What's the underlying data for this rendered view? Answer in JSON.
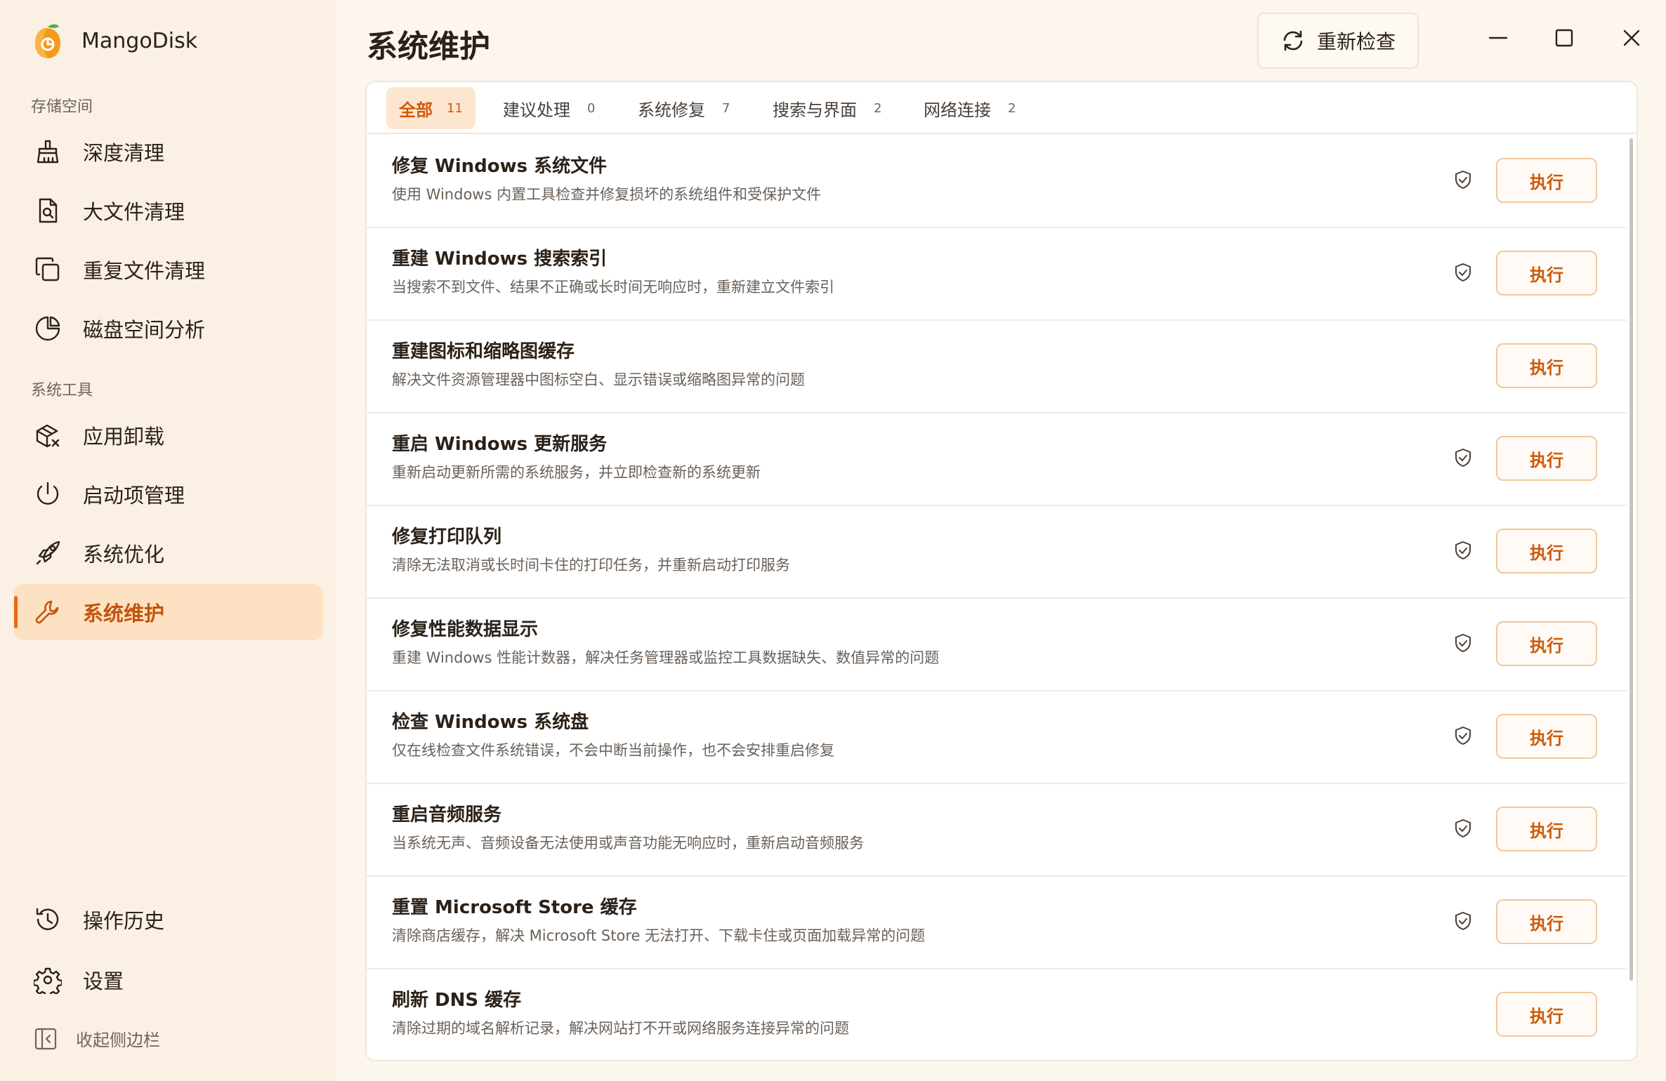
{
  "app": {
    "name": "MangoDisk"
  },
  "sidebar": {
    "groups": [
      {
        "title": "存储空间"
      },
      {
        "title": "系统工具"
      }
    ],
    "items": [
      {
        "label": "深度清理",
        "icon": "broom-icon"
      },
      {
        "label": "大文件清理",
        "icon": "file-search-icon"
      },
      {
        "label": "重复文件清理",
        "icon": "copy-icon"
      },
      {
        "label": "磁盘空间分析",
        "icon": "pie-chart-icon"
      },
      {
        "label": "应用卸载",
        "icon": "package-x-icon"
      },
      {
        "label": "启动项管理",
        "icon": "power-icon"
      },
      {
        "label": "系统优化",
        "icon": "rocket-icon"
      },
      {
        "label": "系统维护",
        "icon": "wrench-icon",
        "active": true
      }
    ],
    "bottom": [
      {
        "label": "操作历史",
        "icon": "history-icon"
      },
      {
        "label": "设置",
        "icon": "gear-icon"
      }
    ],
    "collapse_label": "收起侧边栏"
  },
  "header": {
    "title": "系统维护",
    "recheck_label": "重新检查"
  },
  "tabs": [
    {
      "label": "全部",
      "count": "11",
      "active": true
    },
    {
      "label": "建议处理",
      "count": "0"
    },
    {
      "label": "系统修复",
      "count": "7"
    },
    {
      "label": "搜索与界面",
      "count": "2"
    },
    {
      "label": "网络连接",
      "count": "2"
    }
  ],
  "tasks": [
    {
      "title": "修复 Windows 系统文件",
      "desc": "使用 Windows 内置工具检查并修复损坏的系统组件和受保护文件",
      "shield": true,
      "action": "执行"
    },
    {
      "title": "重建 Windows 搜索索引",
      "desc": "当搜索不到文件、结果不正确或长时间无响应时，重新建立文件索引",
      "shield": true,
      "action": "执行"
    },
    {
      "title": "重建图标和缩略图缓存",
      "desc": "解决文件资源管理器中图标空白、显示错误或缩略图异常的问题",
      "shield": false,
      "action": "执行"
    },
    {
      "title": "重启 Windows 更新服务",
      "desc": "重新启动更新所需的系统服务，并立即检查新的系统更新",
      "shield": true,
      "action": "执行"
    },
    {
      "title": "修复打印队列",
      "desc": "清除无法取消或长时间卡住的打印任务，并重新启动打印服务",
      "shield": true,
      "action": "执行"
    },
    {
      "title": "修复性能数据显示",
      "desc": "重建 Windows 性能计数器，解决任务管理器或监控工具数据缺失、数值异常的问题",
      "shield": true,
      "action": "执行"
    },
    {
      "title": "检查 Windows 系统盘",
      "desc": "仅在线检查文件系统错误，不会中断当前操作，也不会安排重启修复",
      "shield": true,
      "action": "执行"
    },
    {
      "title": "重启音频服务",
      "desc": "当系统无声、音频设备无法使用或声音功能无响应时，重新启动音频服务",
      "shield": true,
      "action": "执行"
    },
    {
      "title": "重置 Microsoft Store 缓存",
      "desc": "清除商店缓存，解决 Microsoft Store 无法打开、下载卡住或页面加载异常的问题",
      "shield": true,
      "action": "执行"
    },
    {
      "title": "刷新 DNS 缓存",
      "desc": "清除过期的域名解析记录，解决网站打不开或网络服务连接异常的问题",
      "shield": false,
      "action": "执行"
    }
  ],
  "colors": {
    "accent": "#e86a10",
    "active_bg": "#fde1c3",
    "sidebar_bg": "#fbf0e4"
  }
}
